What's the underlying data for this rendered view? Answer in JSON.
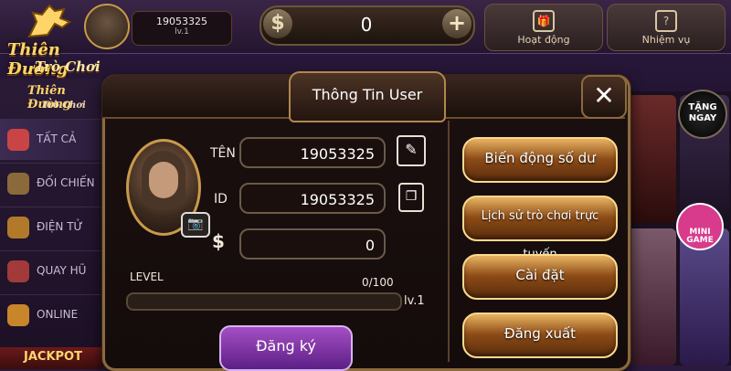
{
  "brand": {
    "line1": "Thiên Đường",
    "line2": "Trò Chơi"
  },
  "top": {
    "user_id": "19053325",
    "user_level": "lv.1",
    "coin_symbol": "$",
    "balance": "0",
    "plus": "+",
    "events_label": "Hoạt động",
    "missions_label": "Nhiệm vụ"
  },
  "nav": {
    "items": [
      {
        "label": "TẤT CẢ",
        "icon": "cards-icon"
      },
      {
        "label": "ĐỐI CHIẾN",
        "icon": "vs-icon"
      },
      {
        "label": "ĐIỆN TỬ",
        "icon": "electronic-icon"
      },
      {
        "label": "QUAY HŨ",
        "icon": "joystick-icon"
      },
      {
        "label": "ONLINE",
        "icon": "online-icon"
      }
    ],
    "jackpot": "JACKPOT"
  },
  "promo": {
    "gift_line1": "TẶNG",
    "gift_line2": "NGAY",
    "mini_line1": "MINI",
    "mini_line2": "GAME"
  },
  "modal": {
    "title": "Thông Tin User",
    "close": "✕",
    "name_label": "TÊN",
    "name_value": "19053325",
    "id_label": "ID",
    "id_value": "19053325",
    "money_label": "$",
    "money_value": "0",
    "level_label": "LEVEL",
    "level_count": "0/100",
    "level_progress": 0,
    "level_tag": "lv.1",
    "register_button": "Đăng ký",
    "buttons": [
      "Biến động số dư",
      "Lịch sử trò chơi trực tuyến",
      "Cài đặt",
      "Đăng xuất"
    ]
  },
  "colors": {
    "gold": "#ffd98c",
    "button_brown": "#8c4b16",
    "register_purple": "#a44fc4"
  }
}
